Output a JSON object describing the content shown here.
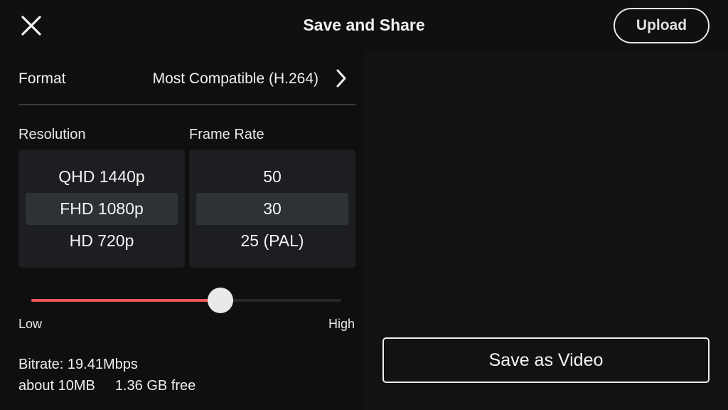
{
  "header": {
    "title": "Save and Share",
    "upload_label": "Upload",
    "close_icon": "close-icon"
  },
  "format": {
    "label": "Format",
    "value": "Most Compatible (H.264)",
    "chevron_icon": "chevron-right-icon"
  },
  "resolution": {
    "label": "Resolution",
    "options": [
      "QHD 1440p",
      "FHD 1080p",
      "HD 720p"
    ],
    "selected": "FHD 1080p"
  },
  "frame_rate": {
    "label": "Frame Rate",
    "options": [
      "50",
      "30",
      "25 (PAL)"
    ],
    "selected": "30"
  },
  "quality_slider": {
    "min_label": "Low",
    "max_label": "High",
    "value_fraction": 0.61,
    "fill_color": "#f05656"
  },
  "stats": {
    "bitrate": "Bitrate: 19.41Mbps",
    "size": "about 10MB",
    "free": "1.36 GB free"
  },
  "actions": {
    "save_label": "Save as Video"
  }
}
